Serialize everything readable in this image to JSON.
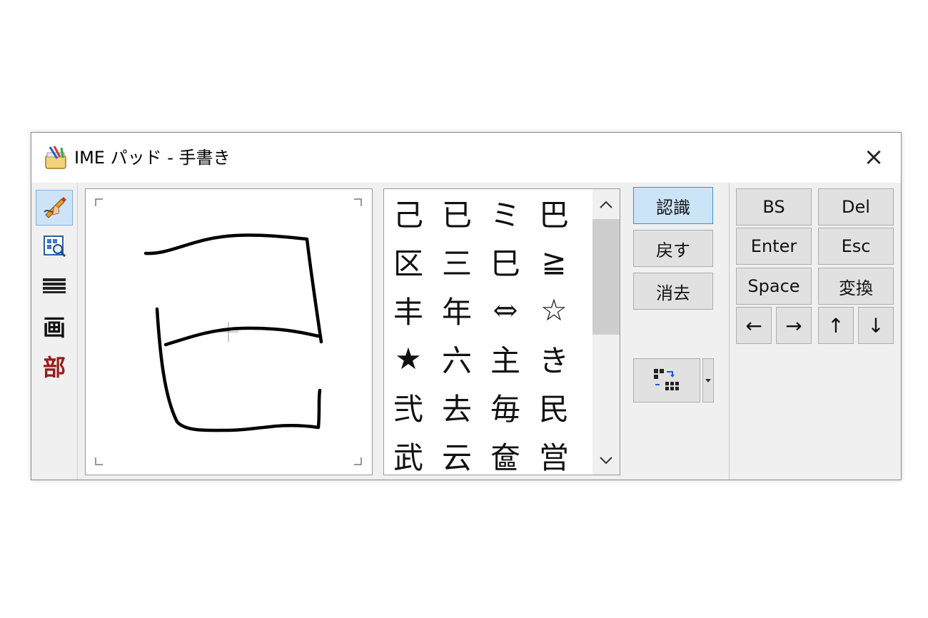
{
  "window": {
    "title": "IME パッド - 手書き",
    "close_label": "×"
  },
  "tools": [
    {
      "name": "handwriting",
      "label": "✍",
      "active": true
    },
    {
      "name": "character-list",
      "label": "🔍",
      "active": false
    },
    {
      "name": "soft-keyboard",
      "label": "⌨",
      "active": false
    },
    {
      "name": "stroke-count",
      "label": "画",
      "active": false
    },
    {
      "name": "radical",
      "label": "部",
      "active": false
    }
  ],
  "candidates": [
    [
      "己",
      "已",
      "ミ",
      "巴"
    ],
    [
      "区",
      "三",
      "巳",
      "≧"
    ],
    [
      "丰",
      "年",
      "⇔",
      "☆"
    ],
    [
      "★",
      "六",
      "主",
      "き"
    ],
    [
      "弐",
      "去",
      "毎",
      "民"
    ],
    [
      "武",
      "云",
      "奩",
      "営"
    ]
  ],
  "scroll": {
    "up": "∧",
    "down": "∨"
  },
  "commands": {
    "recognize": "認識",
    "undo": "戻す",
    "clear": "消去"
  },
  "keys": {
    "bs": "BS",
    "del": "Del",
    "enter": "Enter",
    "esc": "Esc",
    "space": "Space",
    "convert": "変換",
    "left": "←",
    "right": "→",
    "up": "↑",
    "down": "↓"
  }
}
